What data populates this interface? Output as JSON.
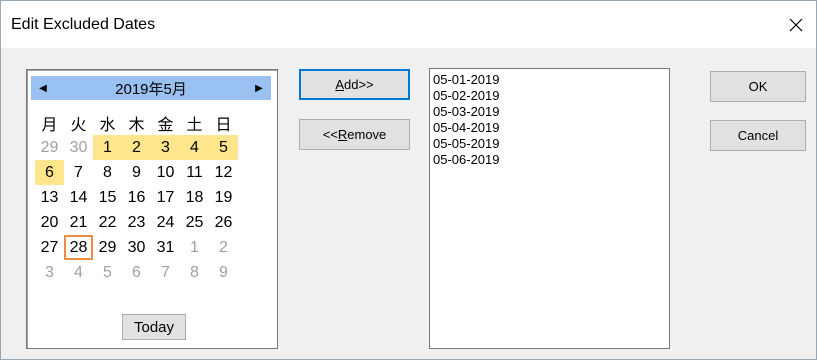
{
  "window": {
    "title": "Edit Excluded Dates"
  },
  "calendar": {
    "month_label": "2019年5月",
    "weekdays": [
      "月",
      "火",
      "水",
      "木",
      "金",
      "土",
      "日"
    ],
    "days": [
      {
        "d": "29",
        "dim": true
      },
      {
        "d": "30",
        "dim": true
      },
      {
        "d": "1",
        "sel": true
      },
      {
        "d": "2",
        "sel": true
      },
      {
        "d": "3",
        "sel": true
      },
      {
        "d": "4",
        "sel": true
      },
      {
        "d": "5",
        "sel": true
      },
      {
        "d": "6",
        "sel": true
      },
      {
        "d": "7"
      },
      {
        "d": "8"
      },
      {
        "d": "9"
      },
      {
        "d": "10"
      },
      {
        "d": "11"
      },
      {
        "d": "12"
      },
      {
        "d": "13"
      },
      {
        "d": "14"
      },
      {
        "d": "15"
      },
      {
        "d": "16"
      },
      {
        "d": "17"
      },
      {
        "d": "18"
      },
      {
        "d": "19"
      },
      {
        "d": "20"
      },
      {
        "d": "21"
      },
      {
        "d": "22"
      },
      {
        "d": "23"
      },
      {
        "d": "24"
      },
      {
        "d": "25"
      },
      {
        "d": "26"
      },
      {
        "d": "27"
      },
      {
        "d": "28",
        "today": true
      },
      {
        "d": "29"
      },
      {
        "d": "30"
      },
      {
        "d": "31"
      },
      {
        "d": "1",
        "dim": true
      },
      {
        "d": "2",
        "dim": true
      },
      {
        "d": "3",
        "dim": true
      },
      {
        "d": "4",
        "dim": true
      },
      {
        "d": "5",
        "dim": true
      },
      {
        "d": "6",
        "dim": true
      },
      {
        "d": "7",
        "dim": true
      },
      {
        "d": "8",
        "dim": true
      },
      {
        "d": "9",
        "dim": true
      }
    ],
    "today_label": "Today"
  },
  "buttons": {
    "add_mnemonic": "A",
    "add_rest": "dd>>",
    "remove_prefix": "<<",
    "remove_mnemonic": "R",
    "remove_rest": "emove",
    "ok": "OK",
    "cancel": "Cancel"
  },
  "excluded_dates": [
    "05-01-2019",
    "05-02-2019",
    "05-03-2019",
    "05-04-2019",
    "05-05-2019",
    "05-06-2019"
  ],
  "colors": {
    "selected_day": "#ffe58c",
    "header": "#99c1f1",
    "today_border": "#ec8d44"
  }
}
